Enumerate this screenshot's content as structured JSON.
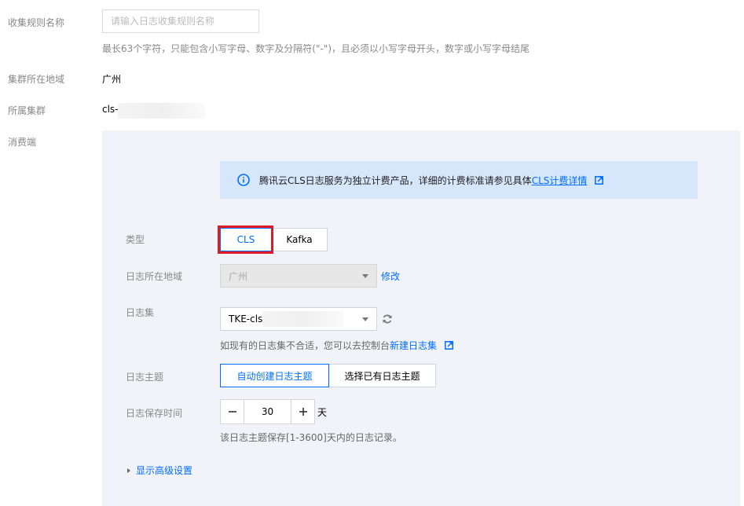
{
  "form": {
    "rule_name_label": "收集规则名称",
    "rule_name_placeholder": "请输入日志收集规则名称",
    "rule_name_value": "",
    "rule_name_hint": "最长63个字符，只能包含小写字母、数字及分隔符(\"-\")，且必须以小写字母开头，数字或小写字母结尾",
    "cluster_region_label": "集群所在地域",
    "cluster_region_value": "广州",
    "cluster_label": "所属集群",
    "cluster_value": "cls-",
    "consumer_label": "消费端"
  },
  "consumer": {
    "notice_prefix": "腾讯云CLS日志服务为独立计费产品，详细的计费标准请参见具体",
    "notice_link": "CLS计费详情",
    "type_label": "类型",
    "type_options": [
      "CLS",
      "Kafka"
    ],
    "type_selected": "CLS",
    "log_region_label": "日志所在地域",
    "log_region_value": "广州",
    "modify_link": "修改",
    "logset_label": "日志集",
    "logset_value": "TKE-cls",
    "logset_hint": "如现有的日志集不合适，您可以去控制台",
    "logset_create_link": "新建日志集",
    "topic_label": "日志主题",
    "topic_options": [
      "自动创建日志主题",
      "选择已有日志主题"
    ],
    "topic_selected": "自动创建日志主题",
    "retention_label": "日志保存时间",
    "retention_value": "30",
    "retention_unit": "天",
    "retention_hint": "该日志主题保存[1-3600]天内的日志记录。",
    "advanced_toggle": "显示高级设置"
  },
  "colors": {
    "accent": "#006eff",
    "highlight_box": "#e01b24",
    "notice_bg": "#d6e6fb",
    "panel_bg": "#f2f3f8"
  },
  "icons": [
    "info-icon",
    "external-link-icon",
    "refresh-icon",
    "minus-icon",
    "plus-icon",
    "caret-right-icon",
    "chevron-down-icon"
  ]
}
